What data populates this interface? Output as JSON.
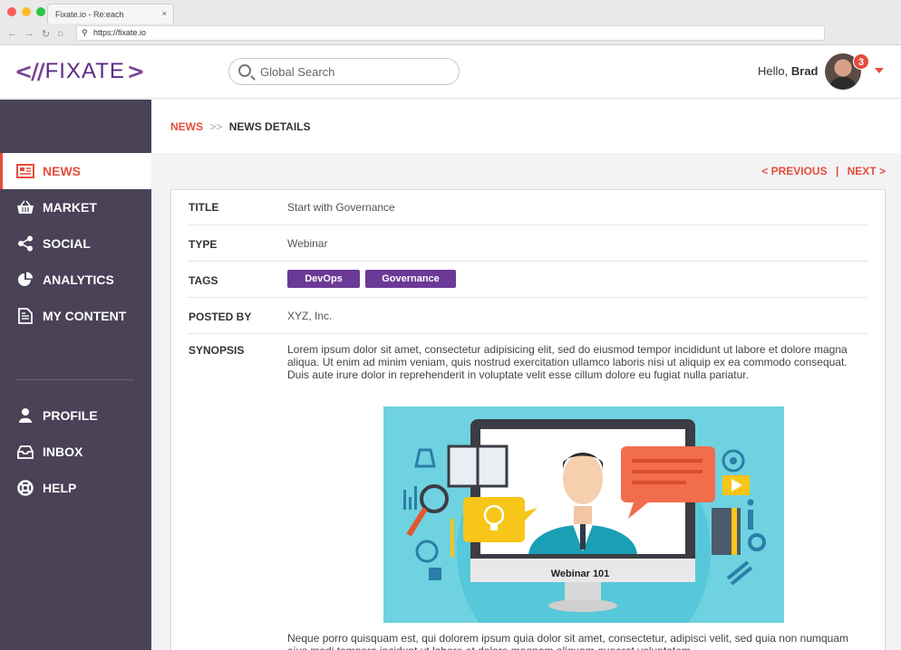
{
  "browser": {
    "tab_title": "Fixate.io - Re:each",
    "tab_close": "×",
    "url": "https://fixate.io"
  },
  "header": {
    "logo_text": "FIXATE",
    "search_placeholder": "Global Search",
    "greeting": "Hello,",
    "user_name": "Brad",
    "notification_count": "3"
  },
  "sidebar": {
    "items": [
      {
        "label": "NEWS",
        "icon": "newspaper-icon",
        "active": true
      },
      {
        "label": "MARKET",
        "icon": "basket-icon"
      },
      {
        "label": "SOCIAL",
        "icon": "share-icon"
      },
      {
        "label": "ANALYTICS",
        "icon": "pie-chart-icon"
      },
      {
        "label": "MY CONTENT",
        "icon": "document-icon"
      },
      {
        "label": "PROFILE",
        "icon": "user-icon"
      },
      {
        "label": "INBOX",
        "icon": "inbox-icon"
      },
      {
        "label": "HELP",
        "icon": "lifebuoy-icon"
      }
    ]
  },
  "breadcrumb": {
    "root": "NEWS",
    "separator": ">>",
    "current": "NEWS DETAILS"
  },
  "pager": {
    "previous": "< PREVIOUS",
    "separator": "|",
    "next": "NEXT >"
  },
  "details": {
    "title_label": "TITLE",
    "title_value": "Start with Governance",
    "type_label": "TYPE",
    "type_value": "Webinar",
    "tags_label": "TAGS",
    "tags": [
      "DevOps",
      "Governance"
    ],
    "posted_label": "POSTED BY",
    "posted_value": "XYZ, Inc.",
    "synopsis_label": "SYNOPSIS",
    "synopsis_text": "Lorem ipsum dolor sit amet, consectetur adipisicing elit, sed do eiusmod tempor incididunt ut labore et dolore magna aliqua. Ut enim ad minim veniam, quis nostrud exercitation ullamco laboris nisi ut aliquip ex ea commodo consequat. Duis aute irure dolor in reprehenderit in voluptate velit esse cillum dolore eu fugiat nulla pariatur.",
    "image_caption": "Webinar 101",
    "after_text": "Neque porro quisquam est, qui dolorem ipsum quia dolor sit amet, consectetur, adipisci velit, sed quia non numquam eius modi tempora incidunt ut labore et dolore magnam aliquam quaerat voluptatem."
  },
  "colors": {
    "accent": "#e64c3c",
    "sidebar_bg": "#4a4257",
    "tag_bg": "#6b3a96",
    "hero_bg": "#6fd2e0"
  }
}
